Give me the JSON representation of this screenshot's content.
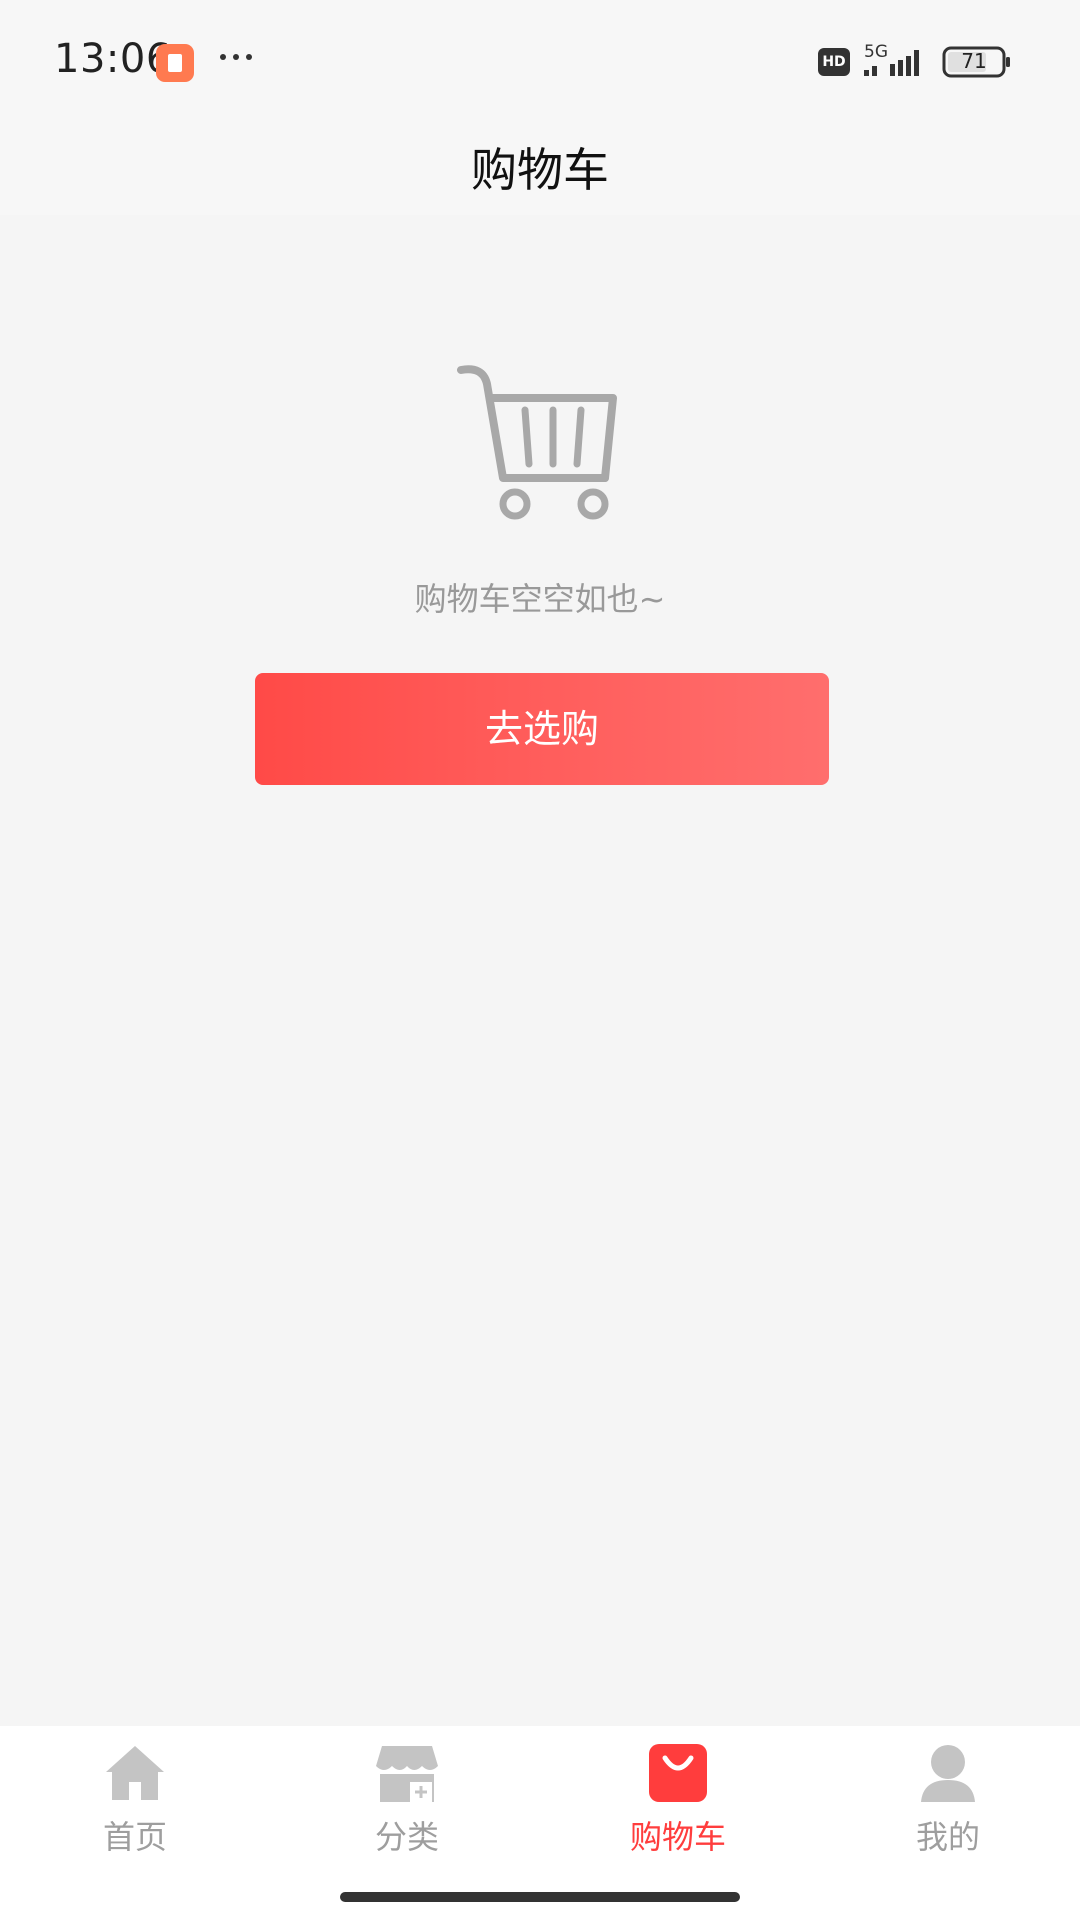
{
  "status_bar": {
    "time": "13:06",
    "network": "5G",
    "hd": "HD",
    "battery": "71"
  },
  "header": {
    "title": "购物车"
  },
  "empty_state": {
    "message": "购物车空空如也~",
    "button_label": "去选购"
  },
  "bottom_nav": {
    "items": [
      {
        "label": "首页",
        "icon": "home-icon"
      },
      {
        "label": "分类",
        "icon": "category-store-icon"
      },
      {
        "label": "购物车",
        "icon": "shopping-bag-icon",
        "active": true
      },
      {
        "label": "我的",
        "icon": "user-profile-icon"
      }
    ]
  },
  "colors": {
    "accent": "#ff3d3d",
    "button_start": "#ff4a47",
    "button_end": "#ff6e6d",
    "inactive": "#bdbdbd",
    "background": "#f5f5f5"
  }
}
